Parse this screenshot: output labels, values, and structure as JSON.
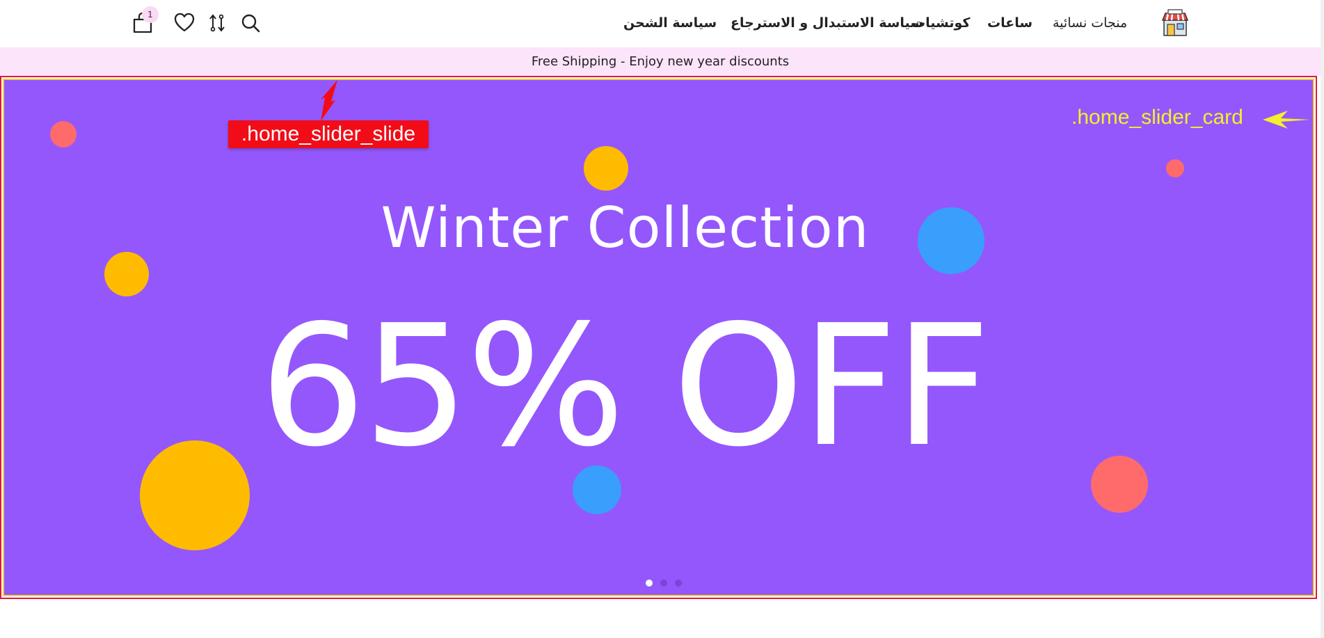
{
  "header": {
    "logo_icon": "store-shopfront-icon",
    "nav": [
      {
        "label": "منجات نسائية"
      },
      {
        "label": "ساعات"
      },
      {
        "label": "كوتشيات"
      },
      {
        "label": "سياسة الاستبدال و الاسترجاع"
      },
      {
        "label": "سياسة الشحن"
      }
    ],
    "icons": [
      "search-icon",
      "compare-icon",
      "heart-icon",
      "shopping-bag-icon"
    ],
    "cart_count": "1"
  },
  "announcement": {
    "text": "Free Shipping - Enjoy new year discounts"
  },
  "slider": {
    "title": "Winter Collection",
    "offer": "65% OFF",
    "pager_count": 3,
    "active_index": 0,
    "background": "#9457fc"
  },
  "annotations": {
    "slide_label": ".home_slider_slide",
    "card_label": ".home_slider_card"
  },
  "colors": {
    "accent_pink": "#fce4fb",
    "yellow": "#ffbb00",
    "coral": "#ff6b6b",
    "blue": "#3a9efd"
  }
}
